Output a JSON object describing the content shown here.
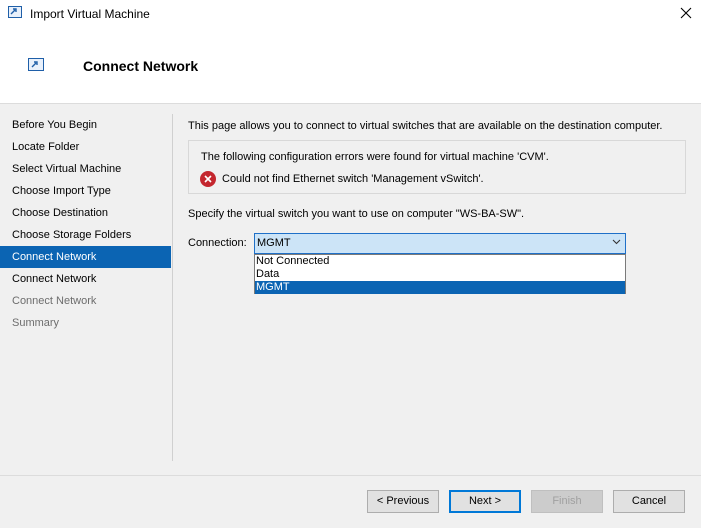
{
  "window": {
    "title": "Import Virtual Machine",
    "close_icon": "close-icon",
    "app_icon": "import-vm-icon"
  },
  "header": {
    "title": "Connect Network",
    "icon": "import-vm-icon"
  },
  "nav": {
    "items": [
      {
        "label": "Before You Begin",
        "state": "normal"
      },
      {
        "label": "Locate Folder",
        "state": "normal"
      },
      {
        "label": "Select Virtual Machine",
        "state": "normal"
      },
      {
        "label": "Choose Import Type",
        "state": "normal"
      },
      {
        "label": "Choose Destination",
        "state": "normal"
      },
      {
        "label": "Choose Storage Folders",
        "state": "normal"
      },
      {
        "label": "Connect Network",
        "state": "selected"
      },
      {
        "label": "Connect Network",
        "state": "normal"
      },
      {
        "label": "Connect Network",
        "state": "disabled"
      },
      {
        "label": "Summary",
        "state": "disabled"
      }
    ]
  },
  "main": {
    "description": "This page allows you to connect to virtual switches that are available on the destination computer.",
    "error_box": {
      "message": "The following configuration errors were found for virtual machine 'CVM'.",
      "detail": "Could not find Ethernet switch 'Management vSwitch'.",
      "icon": "error-icon",
      "icon_color": "#c4262e"
    },
    "specify": "Specify the virtual switch you want to use on computer \"WS-BA-SW\".",
    "connection": {
      "label": "Connection:",
      "value": "MGMT",
      "options": [
        "Not Connected",
        "Data",
        "MGMT"
      ],
      "selected_index": 2
    }
  },
  "footer": {
    "previous": "< Previous",
    "next": "Next >",
    "finish": "Finish",
    "cancel": "Cancel"
  },
  "colors": {
    "accent": "#0b64b3",
    "select_bg": "#cce4f7",
    "error": "#c4262e"
  }
}
